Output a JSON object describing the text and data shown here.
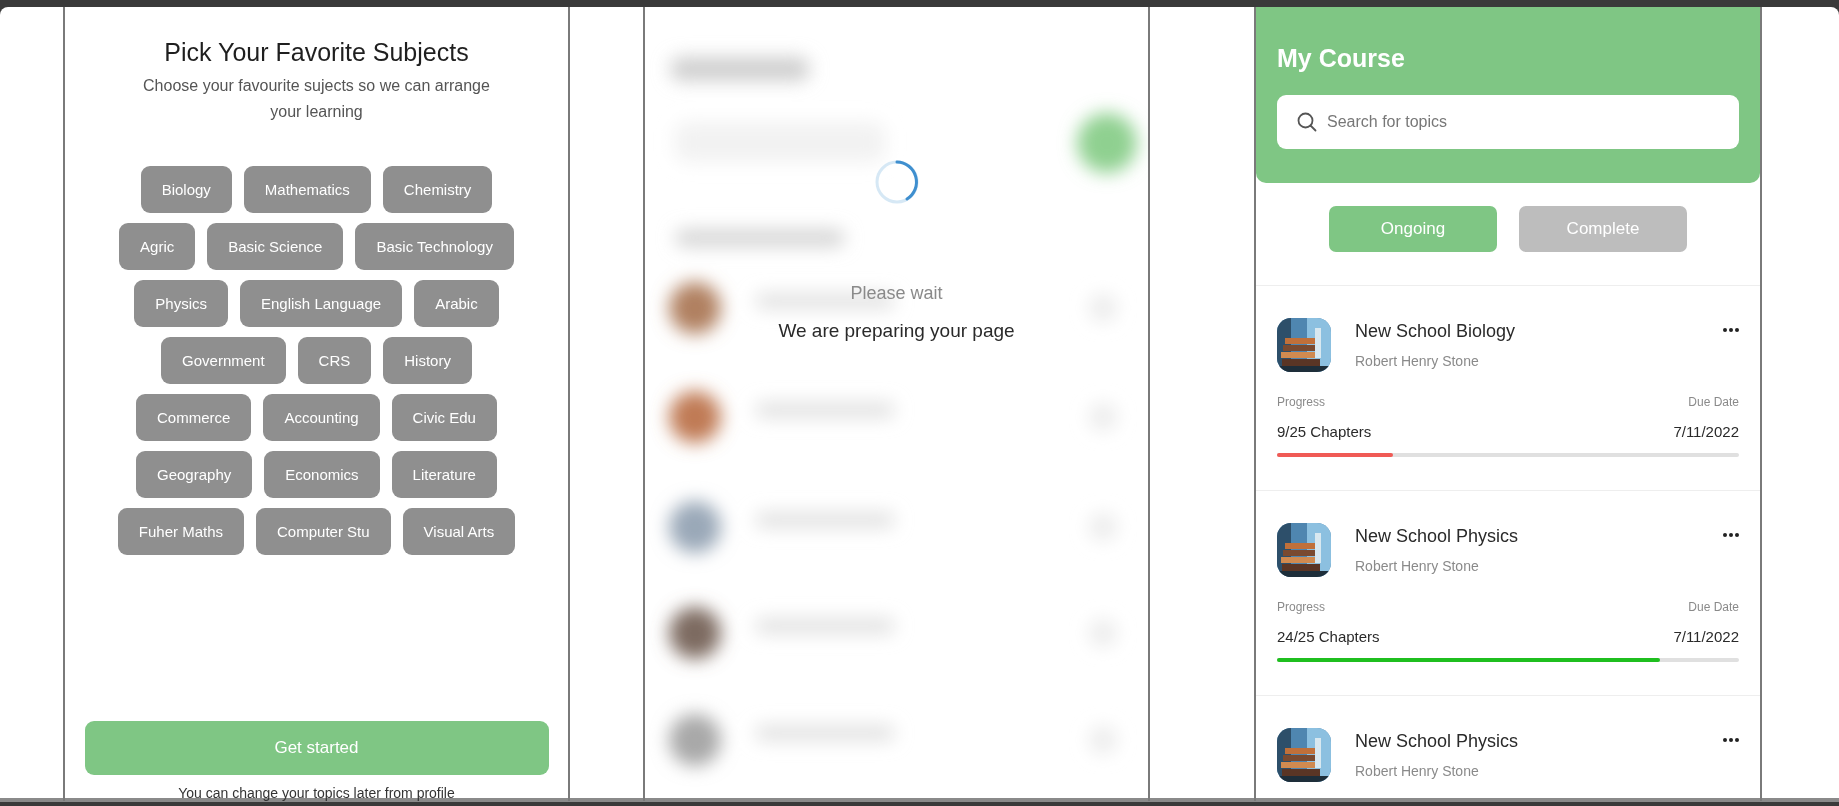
{
  "subjects_screen": {
    "title": "Pick Your Favorite Subjects",
    "subtitle": "Choose your favourite sujects so we can arrange your learning",
    "subject_rows": [
      [
        {
          "label": "Biology",
          "selected": false
        },
        {
          "label": "Mathematics",
          "selected": false
        },
        {
          "label": "Chemistry",
          "selected": false
        }
      ],
      [
        {
          "label": "Agric",
          "selected": false
        },
        {
          "label": "Basic Science",
          "selected": false
        },
        {
          "label": "Basic Technology",
          "selected": false
        }
      ],
      [
        {
          "label": "Physics",
          "selected": false
        },
        {
          "label": "English Language",
          "selected": false
        },
        {
          "label": "Arabic",
          "selected": false
        }
      ],
      [
        {
          "label": "Government",
          "selected": false
        },
        {
          "label": "CRS",
          "selected": false
        },
        {
          "label": "History",
          "selected": false
        }
      ],
      [
        {
          "label": "Commerce",
          "selected": false
        },
        {
          "label": "Accounting",
          "selected": false
        },
        {
          "label": "Civic Edu",
          "selected": false
        }
      ],
      [
        {
          "label": "Geography",
          "selected": false
        },
        {
          "label": "Economics",
          "selected": false
        },
        {
          "label": "Literature",
          "selected": false
        }
      ],
      [
        {
          "label": "Fuher Maths",
          "selected": false
        },
        {
          "label": "Computer Stu",
          "selected": false
        },
        {
          "label": "Visual Arts",
          "selected": false
        }
      ]
    ],
    "button": "Get started",
    "footnote": "You can change your topics later from profile"
  },
  "loading_screen": {
    "status": "Please wait",
    "message": "We are preparing your page"
  },
  "course_screen": {
    "title": "My Course",
    "search": {
      "placeholder": "Search for topics"
    },
    "tabs": [
      {
        "label": "Ongoing",
        "selected": true
      },
      {
        "label": "Complete",
        "selected": false
      }
    ],
    "courses": [
      {
        "title": "New School Biology",
        "author": "Robert Henry Stone",
        "progress_label": "Progress",
        "progress": "9/25 Chapters",
        "due_label": "Due Date",
        "due_date": "7/11/2022",
        "level": 0.25,
        "color": "#f05a55"
      },
      {
        "title": "New School Physics",
        "author": "Robert Henry Stone",
        "progress_label": "Progress",
        "progress": "24/25 Chapters",
        "due_label": "Due Date",
        "due_date": "7/11/2022",
        "level": 0.83,
        "color": "#1fbf1f"
      },
      {
        "title": "New School Physics",
        "author": "Robert Henry Stone"
      }
    ]
  }
}
